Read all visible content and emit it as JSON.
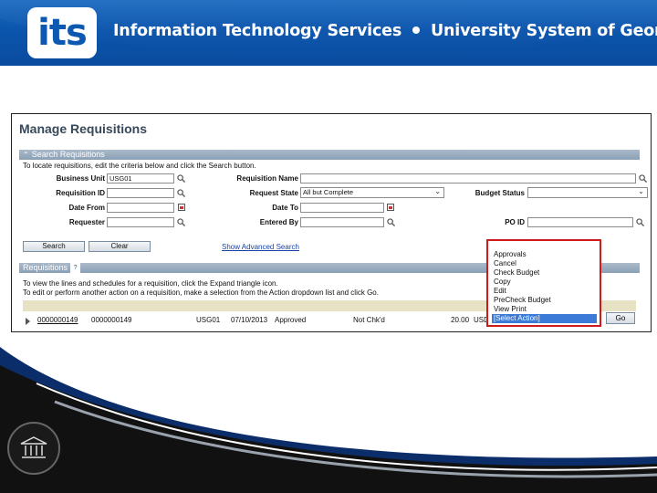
{
  "banner": {
    "logo_text": "its",
    "title_left": "Information Technology Services",
    "title_right": "University System of Georgia"
  },
  "page": {
    "title": "Manage Requisitions"
  },
  "search_section": {
    "header": "Search Requisitions",
    "instructions": "To locate requisitions, edit the criteria below and click the Search button.",
    "fields": {
      "business_unit": {
        "label": "Business Unit",
        "value": "USG01"
      },
      "requisition_name": {
        "label": "Requisition Name",
        "value": ""
      },
      "requisition_id": {
        "label": "Requisition ID",
        "value": ""
      },
      "request_state": {
        "label": "Request State",
        "value": "All but Complete"
      },
      "budget_status": {
        "label": "Budget Status",
        "value": ""
      },
      "date_from": {
        "label": "Date From",
        "value": ""
      },
      "date_to": {
        "label": "Date To",
        "value": ""
      },
      "requester": {
        "label": "Requester",
        "value": ""
      },
      "entered_by": {
        "label": "Entered By",
        "value": ""
      },
      "po_id": {
        "label": "PO ID",
        "value": ""
      }
    },
    "buttons": {
      "search": "Search",
      "clear": "Clear"
    },
    "advanced_link": "Show Advanced Search"
  },
  "requisitions_section": {
    "header": "Requisitions",
    "instructions_1": "To view the lines and schedules for a requisition, click the Expand triangle icon.",
    "instructions_2": "To edit or perform another action on a requisition, make a selection from the Action dropdown list and click Go.",
    "row": {
      "req_id_link": "0000000149",
      "req_name": "0000000149",
      "bu": "USG01",
      "date": "07/10/2013",
      "status": "Approved",
      "budget": "Not Chk'd",
      "total": "20.00",
      "currency": "USD"
    }
  },
  "action_dropdown": {
    "options": [
      "Approvals",
      "Cancel",
      "Check Budget",
      "Copy",
      "Edit",
      "PreCheck Budget",
      "View Print"
    ],
    "selected": "[Select Action]",
    "highlight_color": "#d01a1a"
  },
  "go_button": "Go"
}
